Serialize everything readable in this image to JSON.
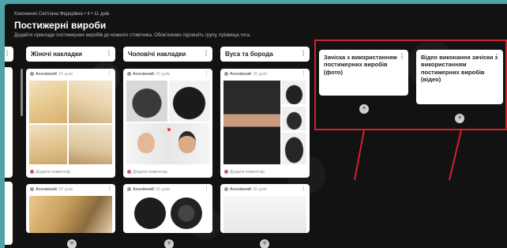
{
  "page": {
    "author": "Кононенко Світлана Федорівна • 4 • 11 днів",
    "title": "Постижерні вироби",
    "description": "Додайте приклади постижерних виробів до кожного стовпчика. Обов’язково підпишіть групу, прізвища тега."
  },
  "columns": [
    {
      "title": "Жіночі накладки"
    },
    {
      "title": "Чоловічі накладки"
    },
    {
      "title": "Вуса та борода"
    }
  ],
  "cards": {
    "author": "Анонімний",
    "date": "20 днів",
    "comment_placeholder": "Додати коментар"
  },
  "annotated_cards": [
    {
      "text": "Зачіска з використанням постижерних виробів (фото)"
    },
    {
      "text": "Відео виконання зачіски з використанням постижерних виробів (відео)"
    }
  ],
  "icons": {
    "add": "+",
    "more": "⋮",
    "plus_icon": "plus-icon",
    "kebab_icon": "more-icon"
  },
  "colors": {
    "annotation": "#d3212a",
    "background": "#121212",
    "frame": "#4fa3a6"
  }
}
